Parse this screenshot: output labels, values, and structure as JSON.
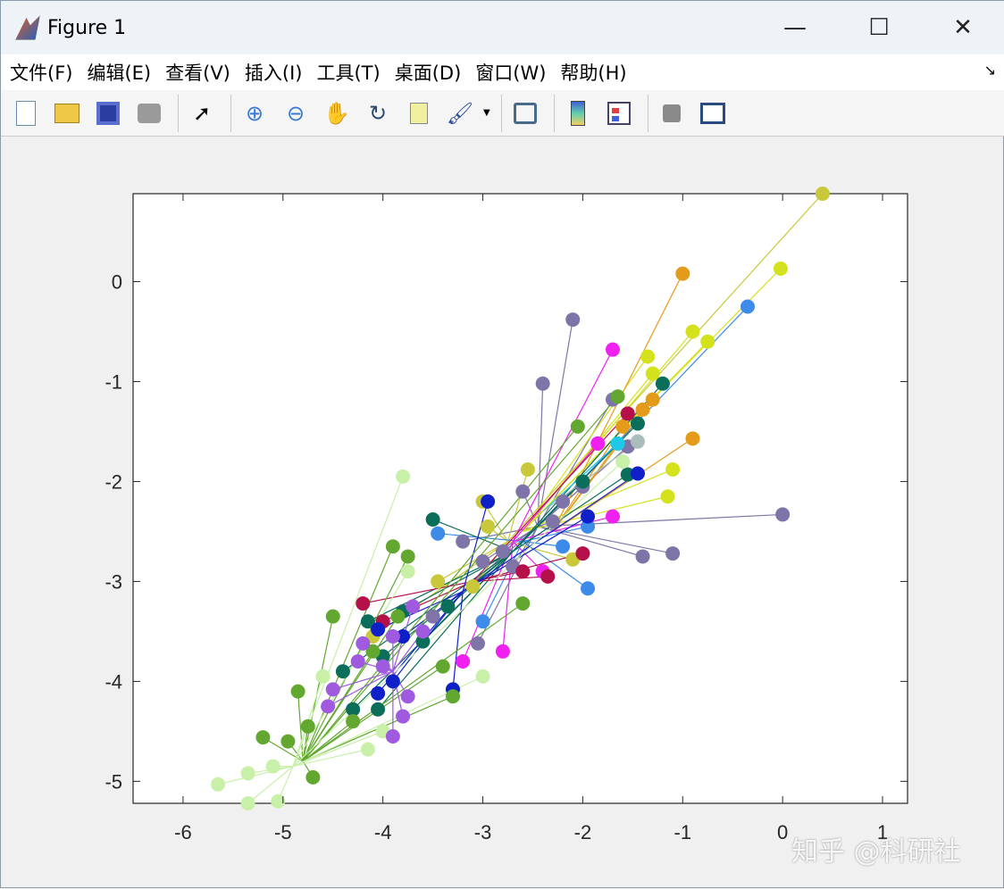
{
  "window": {
    "title": "Figure 1",
    "minimize": "—",
    "maximize": "☐",
    "close": "✕"
  },
  "menu": [
    "文件(F)",
    "编辑(E)",
    "查看(V)",
    "插入(I)",
    "工具(T)",
    "桌面(D)",
    "窗口(W)",
    "帮助(H)"
  ],
  "toolbar": [
    "new-figure",
    "open-file",
    "save",
    "print",
    "edit-plot",
    "zoom-in",
    "zoom-out",
    "pan",
    "rotate-3d",
    "data-cursor",
    "brush",
    "link-plot",
    "insert-colorbar",
    "insert-legend",
    "hide-plot-tools",
    "show-plot-tools"
  ],
  "watermark": "知乎 @科研社",
  "chart_data": {
    "type": "scatter",
    "title": "",
    "xlabel": "",
    "ylabel": "",
    "xlim": [
      -6.5,
      1.25
    ],
    "ylim": [
      -5.22,
      0.88
    ],
    "xticks": [
      -6,
      -5,
      -4,
      -3,
      -2,
      -1,
      0,
      1
    ],
    "yticks": [
      0,
      -1,
      -2,
      -3,
      -4,
      -5
    ],
    "grid": false,
    "series": [
      {
        "name": "c1",
        "color": "#7f74a8",
        "center": [
          -2.45,
          -2.45
        ],
        "points": [
          [
            -2.1,
            -0.38
          ],
          [
            -2.4,
            -1.02
          ],
          [
            -1.7,
            -1.18
          ],
          [
            0,
            -2.33
          ],
          [
            -1.4,
            -2.75
          ],
          [
            -1.1,
            -2.72
          ],
          [
            -1.55,
            -1.65
          ],
          [
            -2.2,
            -2.2
          ],
          [
            -2.6,
            -2.1
          ],
          [
            -2.8,
            -2.7
          ],
          [
            -3.0,
            -2.8
          ],
          [
            -2.3,
            -2.4
          ],
          [
            -3.5,
            -3.35
          ],
          [
            -3.05,
            -3.62
          ],
          [
            -2.0,
            -2.05
          ],
          [
            -2.7,
            -2.85
          ],
          [
            -3.2,
            -2.6
          ]
        ]
      },
      {
        "name": "c2",
        "color": "#c8c83a",
        "center": [
          -2.75,
          -2.6
        ],
        "points": [
          [
            0.4,
            0.88
          ],
          [
            -2.1,
            -2.78
          ],
          [
            -3.0,
            -2.2
          ],
          [
            -2.55,
            -1.88
          ],
          [
            -3.1,
            -3.05
          ],
          [
            -3.45,
            -3.0
          ],
          [
            -4.1,
            -3.55
          ],
          [
            -2.95,
            -2.45
          ]
        ]
      },
      {
        "name": "c3",
        "color": "#d4e21e",
        "center": [
          -2.6,
          -2.5
        ],
        "points": [
          [
            -0.02,
            0.13
          ],
          [
            -0.9,
            -0.5
          ],
          [
            -0.75,
            -0.6
          ],
          [
            -1.35,
            -0.75
          ],
          [
            -1.1,
            -1.88
          ],
          [
            -1.15,
            -2.15
          ],
          [
            -1.3,
            -0.92
          ]
        ]
      },
      {
        "name": "c4",
        "color": "#e59b1a",
        "center": [
          -2.3,
          -2.5
        ],
        "points": [
          [
            -1.0,
            0.08
          ],
          [
            -0.9,
            -1.57
          ],
          [
            -1.3,
            -1.18
          ],
          [
            -1.4,
            -1.28
          ],
          [
            -1.6,
            -1.45
          ]
        ]
      },
      {
        "name": "c5",
        "color": "#3d8be8",
        "center": [
          -2.6,
          -2.6
        ],
        "points": [
          [
            -0.35,
            -0.25
          ],
          [
            -2.2,
            -2.65
          ],
          [
            -1.95,
            -3.07
          ],
          [
            -3.45,
            -2.52
          ],
          [
            -3.0,
            -3.4
          ],
          [
            -1.95,
            -2.45
          ]
        ]
      },
      {
        "name": "c6",
        "color": "#f020f0",
        "center": [
          -2.7,
          -2.6
        ],
        "points": [
          [
            -1.7,
            -0.68
          ],
          [
            -2.8,
            -3.7
          ],
          [
            -1.7,
            -2.35
          ],
          [
            -2.4,
            -2.9
          ],
          [
            -3.2,
            -3.8
          ],
          [
            -1.85,
            -1.62
          ]
        ]
      },
      {
        "name": "c7",
        "color": "#0a6e5a",
        "center": [
          -2.7,
          -2.7
        ],
        "points": [
          [
            -1.2,
            -1.02
          ],
          [
            -3.5,
            -2.38
          ],
          [
            -4.3,
            -4.28
          ],
          [
            -4.4,
            -3.9
          ],
          [
            -4.05,
            -4.28
          ],
          [
            -1.45,
            -1.42
          ],
          [
            -1.55,
            -1.93
          ],
          [
            -4.15,
            -3.4
          ],
          [
            -3.35,
            -3.25
          ],
          [
            -2.0,
            -2.0
          ],
          [
            -3.8,
            -3.3
          ],
          [
            -3.6,
            -3.6
          ],
          [
            -4.0,
            -3.75
          ]
        ]
      },
      {
        "name": "c8",
        "color": "#b5104a",
        "center": [
          -3.1,
          -3.0
        ],
        "points": [
          [
            -4.2,
            -3.22
          ],
          [
            -2.35,
            -2.95
          ],
          [
            -1.55,
            -1.32
          ],
          [
            -2.0,
            -2.72
          ],
          [
            -4.0,
            -3.4
          ],
          [
            -2.6,
            -2.9
          ]
        ]
      },
      {
        "name": "c9",
        "color": "#1020c8",
        "center": [
          -3.2,
          -3.1
        ],
        "points": [
          [
            -3.3,
            -4.08
          ],
          [
            -4.05,
            -4.12
          ],
          [
            -2.95,
            -2.2
          ],
          [
            -3.9,
            -4.0
          ],
          [
            -1.95,
            -2.35
          ],
          [
            -1.45,
            -1.92
          ],
          [
            -4.05,
            -3.48
          ],
          [
            -3.8,
            -3.55
          ]
        ]
      },
      {
        "name": "c10",
        "color": "#62a830",
        "center": [
          -4.8,
          -4.8
        ],
        "points": [
          [
            -5.2,
            -4.56
          ],
          [
            -4.95,
            -4.6
          ],
          [
            -4.7,
            -4.96
          ],
          [
            -4.85,
            -4.1
          ],
          [
            -4.5,
            -3.35
          ],
          [
            -3.9,
            -2.65
          ],
          [
            -3.75,
            -2.75
          ],
          [
            -2.6,
            -3.22
          ],
          [
            -4.75,
            -4.45
          ],
          [
            -1.65,
            -1.15
          ],
          [
            -2.05,
            -1.45
          ],
          [
            -3.3,
            -4.15
          ],
          [
            -3.4,
            -3.85
          ],
          [
            -4.3,
            -4.4
          ],
          [
            -3.85,
            -3.35
          ],
          [
            -4.1,
            -3.7
          ]
        ]
      },
      {
        "name": "c11",
        "color": "#c8f0a8",
        "center": [
          -4.9,
          -4.85
        ],
        "points": [
          [
            -5.65,
            -5.03
          ],
          [
            -5.35,
            -5.22
          ],
          [
            -5.05,
            -5.2
          ],
          [
            -5.35,
            -4.92
          ],
          [
            -3.8,
            -1.95
          ],
          [
            -4.15,
            -4.68
          ],
          [
            -4.6,
            -3.95
          ],
          [
            -5.1,
            -4.85
          ],
          [
            -3.75,
            -2.9
          ],
          [
            -1.6,
            -1.8
          ],
          [
            -3.0,
            -3.95
          ],
          [
            -4.0,
            -4.5
          ]
        ]
      },
      {
        "name": "c12",
        "color": "#a05ae0",
        "center": [
          -3.9,
          -3.9
        ],
        "points": [
          [
            -3.9,
            -4.55
          ],
          [
            -3.8,
            -4.35
          ],
          [
            -4.5,
            -4.08
          ],
          [
            -4.55,
            -4.25
          ],
          [
            -4.2,
            -3.62
          ],
          [
            -3.9,
            -3.55
          ],
          [
            -3.6,
            -3.5
          ],
          [
            -4.25,
            -3.8
          ],
          [
            -3.75,
            -4.15
          ],
          [
            -4.0,
            -3.85
          ],
          [
            -3.7,
            -3.25
          ]
        ]
      },
      {
        "name": "c13",
        "color": "#1ec8e8",
        "center": [
          -2.4,
          -2.3
        ],
        "points": [
          [
            -1.65,
            -1.62
          ]
        ]
      },
      {
        "name": "c14",
        "color": "#aabcbc",
        "center": [
          -2.4,
          -2.3
        ],
        "points": [
          [
            -1.45,
            -1.6
          ]
        ]
      }
    ]
  }
}
